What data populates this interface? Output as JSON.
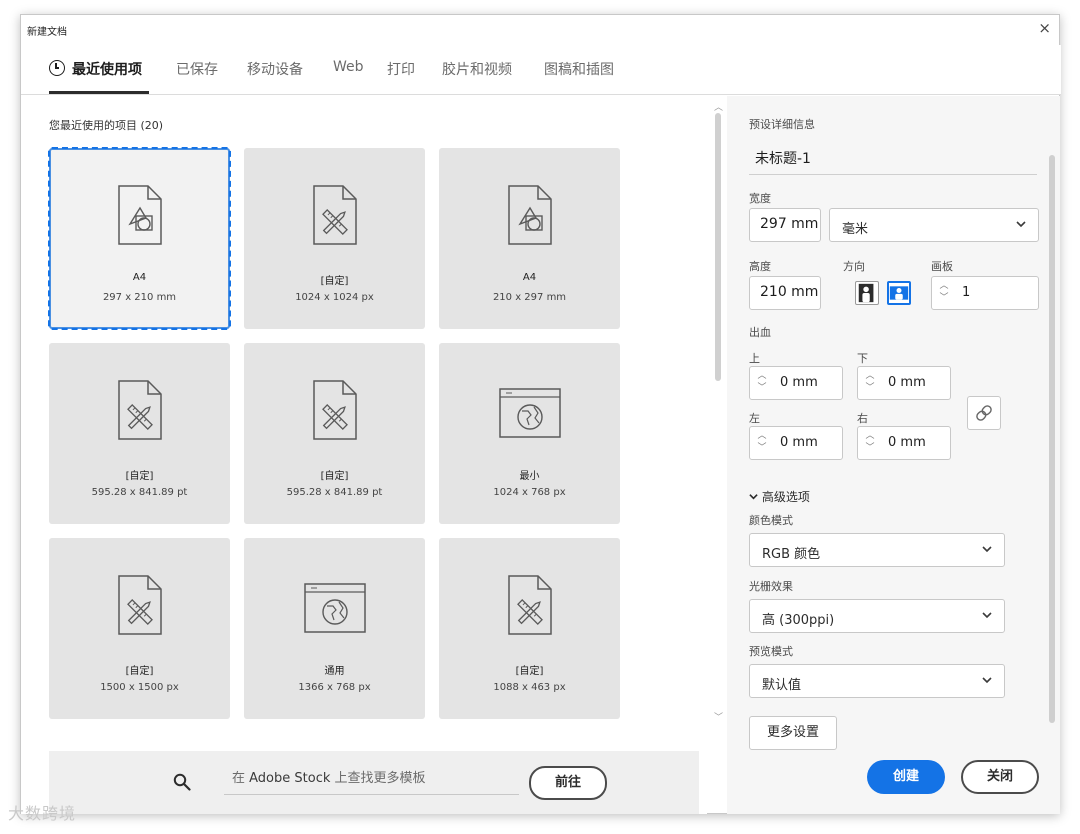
{
  "window": {
    "title": "新建文档",
    "close_glyph": "×"
  },
  "tabs": [
    {
      "label": "最近使用项",
      "active": true
    },
    {
      "label": "已保存"
    },
    {
      "label": "移动设备"
    },
    {
      "label": "Web"
    },
    {
      "label": "打印"
    },
    {
      "label": "胶片和视频"
    },
    {
      "label": "图稿和插图"
    }
  ],
  "recent": {
    "header": "您最近使用的项目 (20)",
    "cards": [
      {
        "name": "A4",
        "size": "297 x 210 mm",
        "icon": "shapes-doc-icon",
        "selected": true
      },
      {
        "name": "[自定]",
        "size": "1024 x 1024 px",
        "icon": "ruler-pencil-doc-icon"
      },
      {
        "name": "A4",
        "size": "210 x 297 mm",
        "icon": "shapes-doc-icon"
      },
      {
        "name": "[自定]",
        "size": "595.28 x 841.89 pt",
        "icon": "ruler-pencil-doc-icon"
      },
      {
        "name": "[自定]",
        "size": "595.28 x 841.89 pt",
        "icon": "ruler-pencil-doc-icon"
      },
      {
        "name": "最小",
        "size": "1024 x 768 px",
        "icon": "web-globe-icon"
      },
      {
        "name": "[自定]",
        "size": "1500 x 1500 px",
        "icon": "ruler-pencil-doc-icon"
      },
      {
        "name": "通用",
        "size": "1366 x 768 px",
        "icon": "web-globe-icon"
      },
      {
        "name": "[自定]",
        "size": "1088 x 463 px",
        "icon": "ruler-pencil-doc-icon"
      }
    ]
  },
  "search": {
    "prefix": "在 ",
    "brand": "Adobe Stock",
    "suffix": " 上查找更多模板",
    "go_label": "前往"
  },
  "preset": {
    "section_label": "预设详细信息",
    "name": "未标题-1",
    "width_label": "宽度",
    "width_value": "297 mm",
    "unit_value": "毫米",
    "height_label": "高度",
    "height_value": "210 mm",
    "orientation_label": "方向",
    "orientation_selected": "landscape",
    "artboard_label": "画板",
    "artboard_value": "1",
    "bleed_label": "出血",
    "bleed_top_label": "上",
    "bleed_top": "0 mm",
    "bleed_bottom_label": "下",
    "bleed_bottom": "0 mm",
    "bleed_left_label": "左",
    "bleed_left": "0 mm",
    "bleed_right_label": "右",
    "bleed_right": "0 mm",
    "advanced_label": "高级选项",
    "color_mode_label": "颜色模式",
    "color_mode_value": "RGB 颜色",
    "raster_label": "光栅效果",
    "raster_value": "高 (300ppi)",
    "preview_label": "预览模式",
    "preview_value": "默认值",
    "more_settings": "更多设置",
    "create_label": "创建",
    "close_label": "关闭"
  },
  "colors": {
    "accent": "#1473e6",
    "card_bg": "#e4e4e4",
    "panel_bg": "#f6f6f6"
  },
  "watermark": "大数跨境"
}
